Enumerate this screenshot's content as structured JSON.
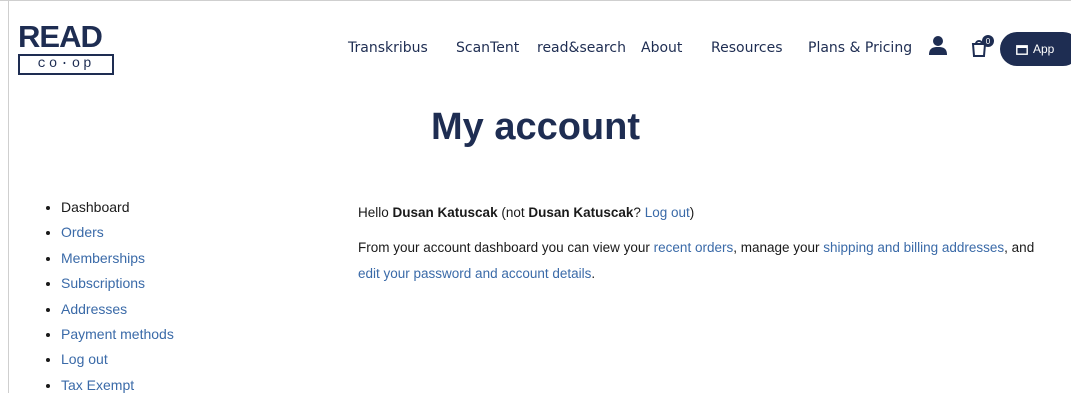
{
  "logo": {
    "top": "READ",
    "bottom": "co·op"
  },
  "nav": {
    "items": [
      "Transkribus",
      "ScanTent",
      "read&search",
      "About",
      "Resources",
      "Plans & Pricing"
    ],
    "cart_count": "0",
    "app_label": "App"
  },
  "page_title": "My account",
  "sidebar": {
    "items": [
      "Dashboard",
      "Orders",
      "Memberships",
      "Subscriptions",
      "Addresses",
      "Payment methods",
      "Log out",
      "Tax Exempt"
    ]
  },
  "content": {
    "hello": "Hello",
    "user_name": "Dusan Katuscak",
    "not_prefix": "(not",
    "user_name_2": "Dusan Katuscak",
    "not_suffix": "?",
    "logout": "Log out",
    "close_paren": ")",
    "para_prefix": "From your account dashboard you can view your",
    "recent_orders": "recent orders",
    "manage": ", manage your",
    "addresses_link": "shipping and billing addresses",
    "and": ", and",
    "password_link": "edit your password and account details",
    "period": "."
  },
  "colors": {
    "brand": "#1e2d52",
    "link": "#3a6aa8"
  }
}
